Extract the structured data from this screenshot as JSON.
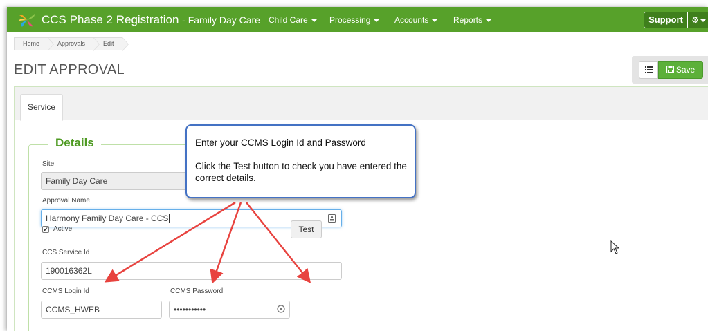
{
  "navbar": {
    "app_title": "CCS Phase 2 Registration",
    "app_subtitle": "- Family Day Care",
    "items": [
      {
        "label": "Child Care"
      },
      {
        "label": "Processing"
      },
      {
        "label": "Accounts"
      },
      {
        "label": "Reports"
      }
    ],
    "support_label": "Support",
    "gear_icon": "gear-icon",
    "brand_color": "#57a12a"
  },
  "breadcrumb": [
    "Home",
    "Approvals",
    "Edit"
  ],
  "page_title": "EDIT APPROVAL",
  "toolbar": {
    "list_icon": "list-icon",
    "save_label": "Save",
    "save_icon": "floppy-disk-icon"
  },
  "tabs": [
    {
      "label": "Service"
    }
  ],
  "details": {
    "title": "Details",
    "site_label": "Site",
    "site_value": "Family Day Care",
    "approval_name_label": "Approval Name",
    "approval_name_value": "Harmony Family Day Care - CCS",
    "active_label": "Active",
    "active_checked": true,
    "ccs_service_id_label": "CCS Service Id",
    "ccs_service_id_value": "190016362L",
    "ccms_login_label": "CCMS Login Id",
    "ccms_login_value": "CCMS_HWEB",
    "ccms_password_label": "CCMS Password",
    "ccms_password_value": "•••••••••••",
    "test_label": "Test"
  },
  "callout": {
    "line1": "Enter your CCMS Login Id and Password",
    "line2": "Click the Test button to check you have entered the correct details.",
    "border_color": "#4472c4",
    "arrow_color": "#e8433f"
  }
}
